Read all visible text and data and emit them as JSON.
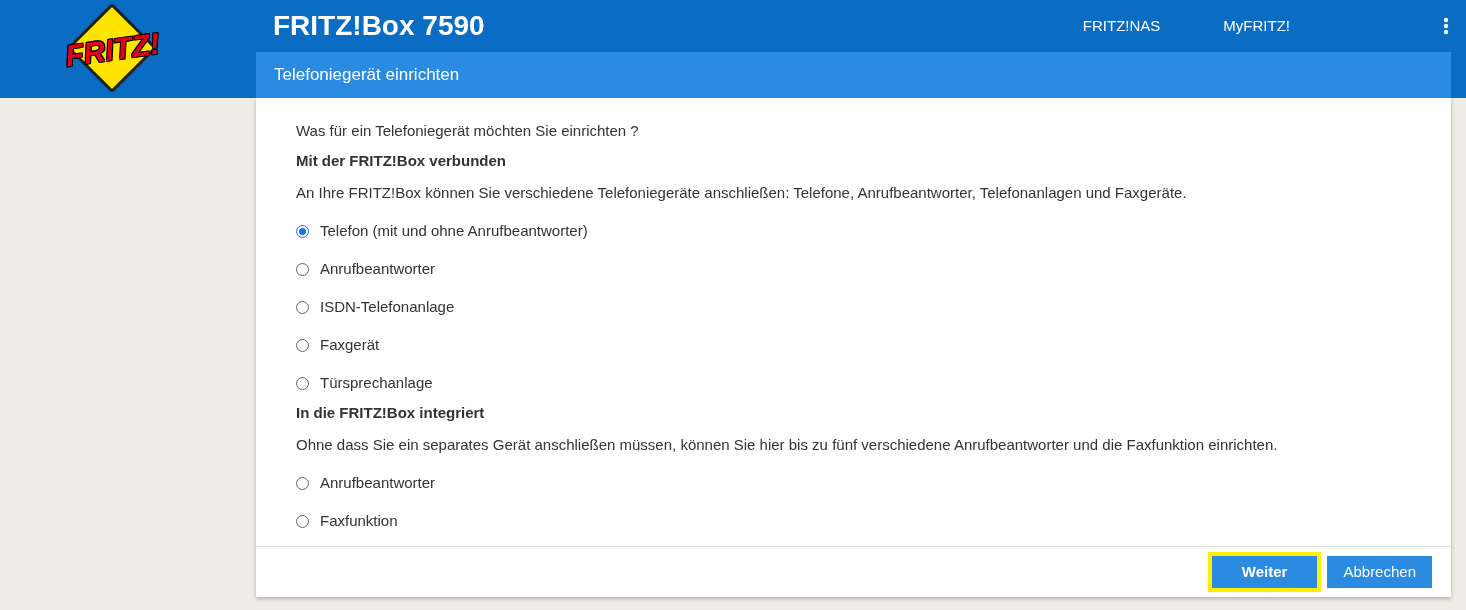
{
  "header": {
    "logo_text": "FRITZ!",
    "title": "FRITZ!Box 7590",
    "links": [
      "FRITZ!NAS",
      "MyFRITZ!"
    ]
  },
  "dialog": {
    "title": "Telefoniegerät einrichten",
    "question": "Was für ein Telefoniegerät möchten Sie einrichten ?",
    "sections": [
      {
        "heading": "Mit der FRITZ!Box verbunden",
        "description": "An Ihre FRITZ!Box können Sie verschiedene Telefoniegeräte anschließen: Telefone, Anrufbeantworter, Telefonanlagen und Faxgeräte.",
        "options": [
          {
            "label": "Telefon (mit und ohne Anrufbeantworter)",
            "selected": true
          },
          {
            "label": "Anrufbeantworter",
            "selected": false
          },
          {
            "label": "ISDN-Telefonanlage",
            "selected": false
          },
          {
            "label": "Faxgerät",
            "selected": false
          },
          {
            "label": "Türsprechanlage",
            "selected": false
          }
        ]
      },
      {
        "heading": "In die FRITZ!Box integriert",
        "description": "Ohne dass Sie ein separates Gerät anschließen müssen, können Sie hier bis zu fünf verschiedene Anrufbeantworter und die Faxfunktion einrichten.",
        "options": [
          {
            "label": "Anrufbeantworter",
            "selected": false
          },
          {
            "label": "Faxfunktion",
            "selected": false
          }
        ]
      }
    ],
    "buttons": [
      {
        "label": "Weiter",
        "highlighted": true
      },
      {
        "label": "Abbrechen",
        "highlighted": false
      }
    ]
  }
}
